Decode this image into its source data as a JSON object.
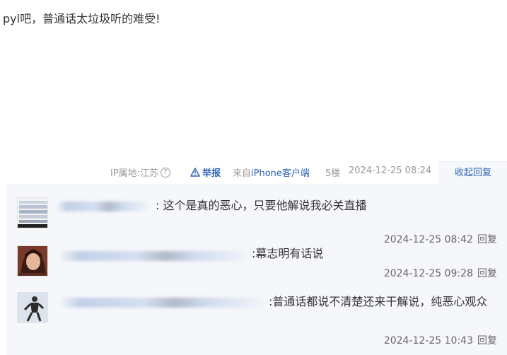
{
  "post": {
    "text": "pyl吧，普通话太垃圾听的难受!"
  },
  "meta": {
    "ip_label": "IP属地:江苏",
    "help_icon": "question-circle-icon",
    "report_label": "举报",
    "source_prefix": "来自",
    "source_device": "iPhone客户端",
    "floor": "5楼",
    "time": "2024-12-25 08:24",
    "collapse_label": "收起回复"
  },
  "replies": [
    {
      "content": ": 这个是真的恶心，只要他解说我必关直播",
      "time": "2024-12-25 08:42",
      "reply_label": "回复"
    },
    {
      "content": ":幕志明有话说",
      "time": "2024-12-25 09:28",
      "reply_label": "回复"
    },
    {
      "content": ":普通话都说不清楚还来干解说，纯恶心观众",
      "time": "2024-12-25 10:43",
      "reply_label": "回复"
    }
  ],
  "colors": {
    "link": "#2d64b3",
    "reply_bg": "#f5f7fa"
  }
}
